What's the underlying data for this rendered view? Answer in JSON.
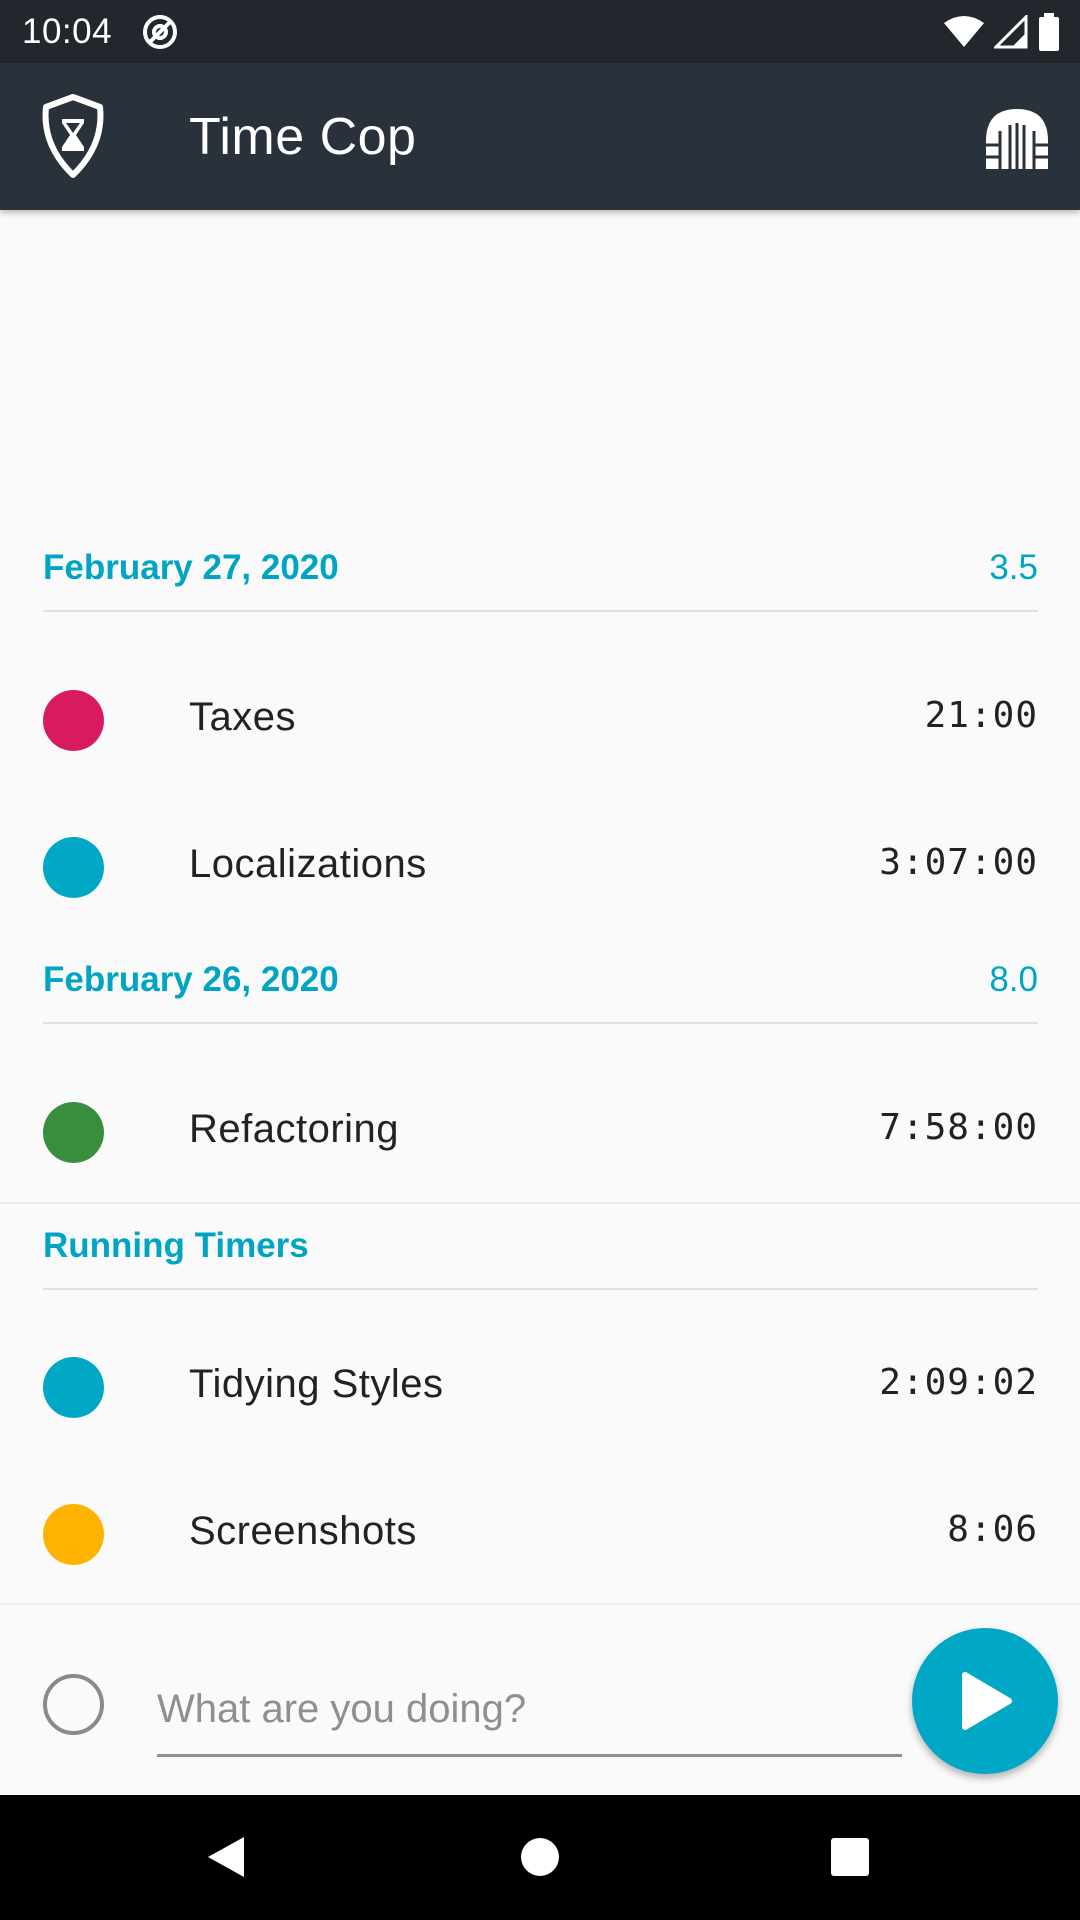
{
  "status_bar": {
    "time": "10:04"
  },
  "app_bar": {
    "title": "Time Cop"
  },
  "groups": [
    {
      "date": "February 27, 2020",
      "hours": "3.5",
      "entries": [
        {
          "name": "Taxes",
          "duration": "21:00",
          "color": "#d81b60"
        },
        {
          "name": "Localizations",
          "duration": "3:07:00",
          "color": "#00a8c6"
        }
      ]
    },
    {
      "date": "February 26, 2020",
      "hours": "8.0",
      "entries": [
        {
          "name": "Refactoring",
          "duration": "7:58:00",
          "color": "#388e3c"
        }
      ]
    }
  ],
  "running": {
    "title": "Running Timers",
    "entries": [
      {
        "name": "Tidying Styles",
        "duration": "2:09:02",
        "color": "#00a8c6"
      },
      {
        "name": "Screenshots",
        "duration": "8:06",
        "color": "#ffb300"
      }
    ]
  },
  "input": {
    "placeholder": "What are you doing?",
    "value": ""
  },
  "colors": {
    "accent": "#00a5c4",
    "app_bar": "#29323a",
    "status_bar": "#21272c"
  },
  "icons": {
    "logo": "badge-hourglass-icon",
    "menu": "gate-icon",
    "fab": "play-icon"
  }
}
